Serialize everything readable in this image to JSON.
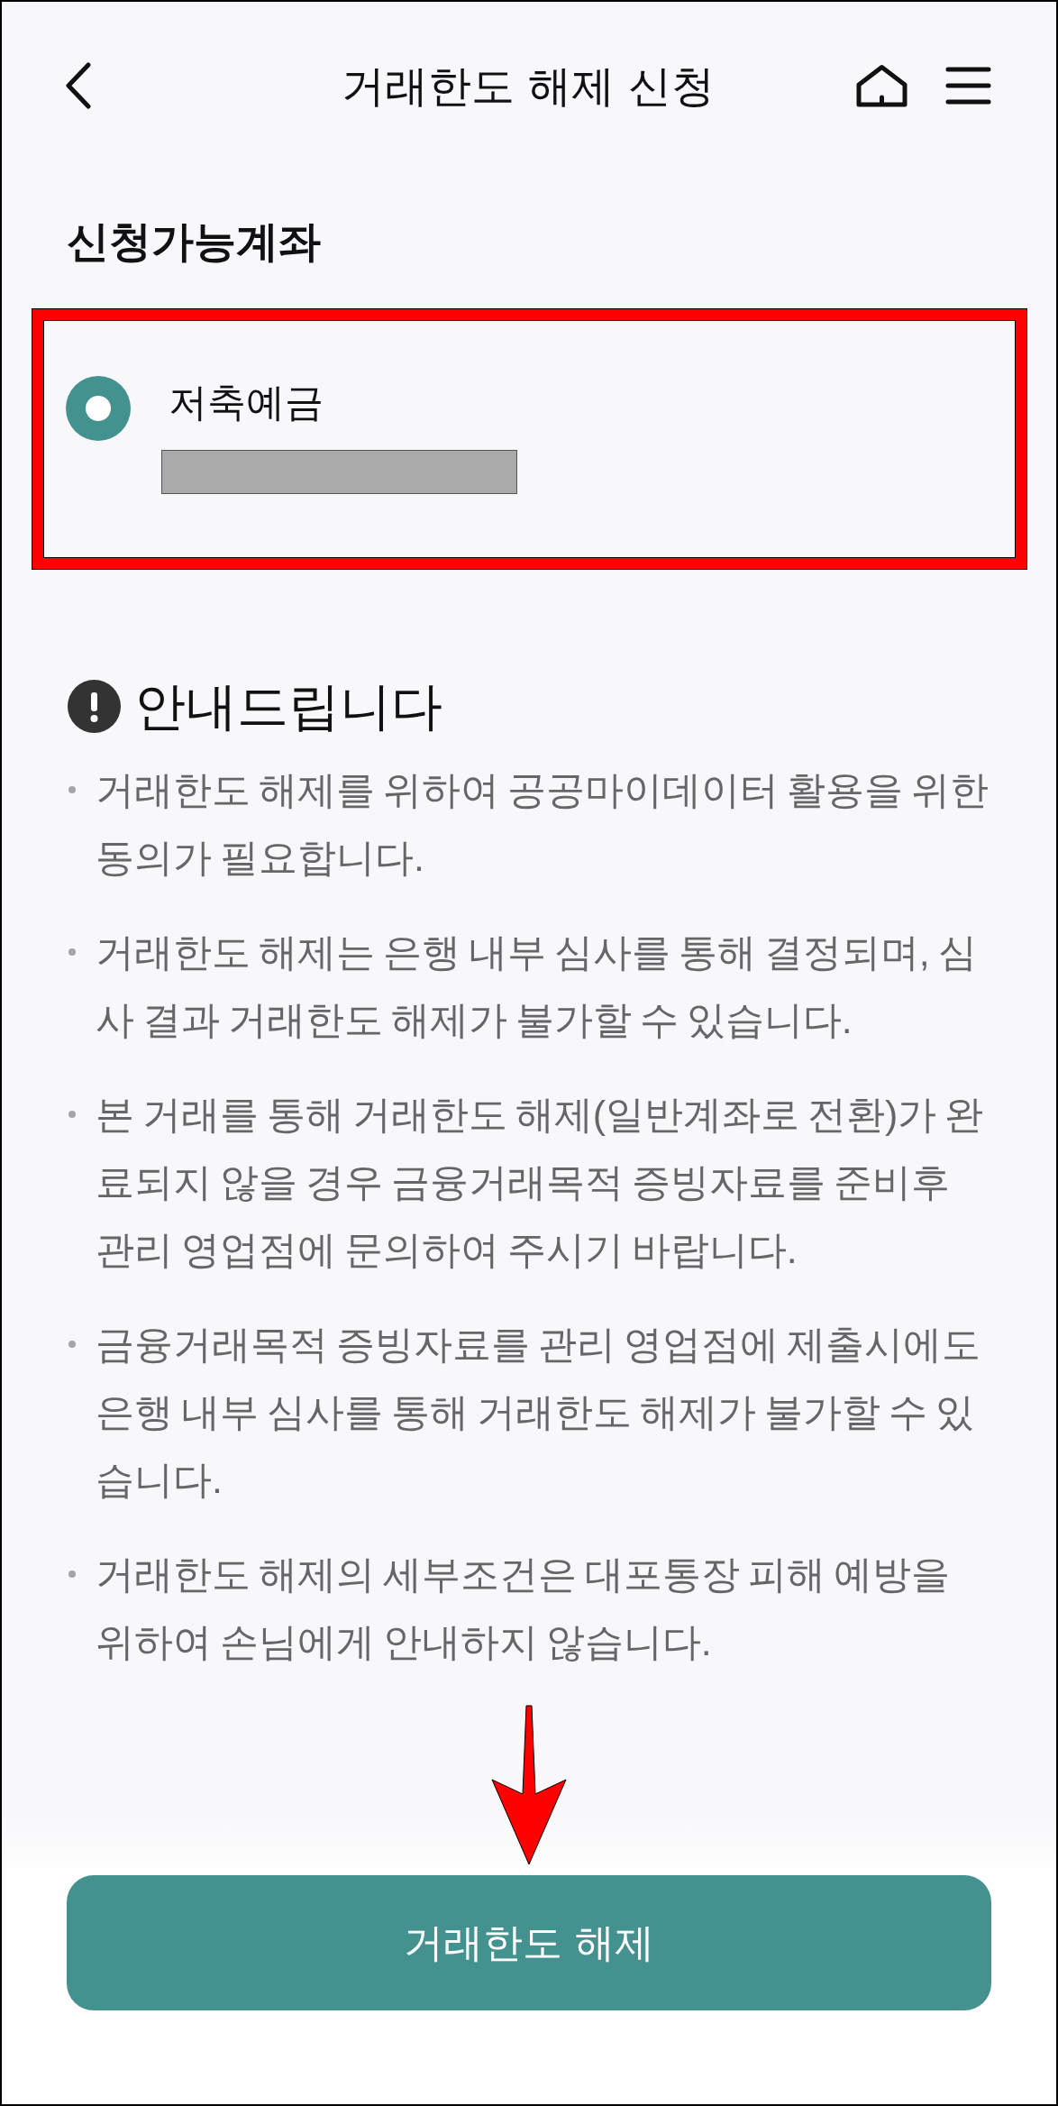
{
  "header": {
    "title": "거래한도 해제 신청"
  },
  "section_title": "신청가능계좌",
  "accounts": [
    {
      "name": "저축예금",
      "selected": true,
      "highlighted": true,
      "number_redacted": true
    }
  ],
  "notice": {
    "title": "안내드립니다",
    "items": [
      "거래한도 해제를 위하여 공공마이데이터 활용을 위한 동의가 필요합니다.",
      "거래한도 해제는 은행 내부 심사를 통해 결정되며, 심사 결과 거래한도 해제가 불가할 수 있습니다.",
      "본 거래를 통해 거래한도 해제(일반계좌로 전환)가 완료되지 않을 경우 금융거래목적 증빙자료를 준비후 관리 영업점에 문의하여 주시기 바랍니다.",
      "금융거래목적 증빙자료를 관리 영업점에 제출시에도 은행 내부 심사를 통해 거래한도 해제가 불가할 수 있습니다.",
      "거래한도 해제의 세부조건은 대포통장 피해 예방을 위하여 손님에게 안내하지 않습니다."
    ]
  },
  "action_button": {
    "label": "거래한도 해제",
    "arrow_marked": true
  }
}
